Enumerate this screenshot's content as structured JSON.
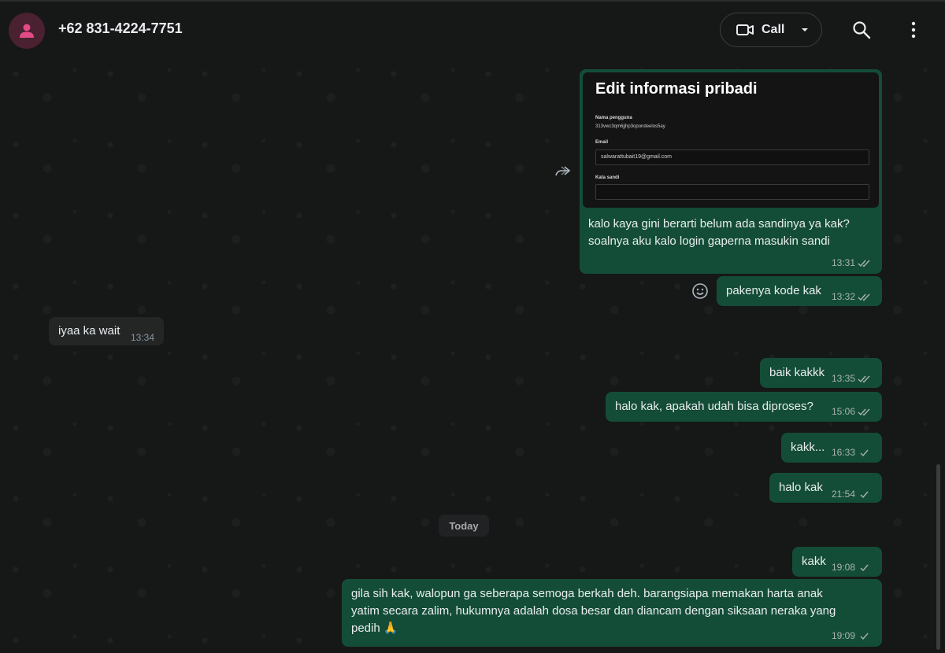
{
  "header": {
    "contact_name": "+62 831-4224-7751",
    "call_label": "Call",
    "avatar_icon": "person-icon",
    "video_icon": "video-camera-icon",
    "dropdown_icon": "chevron-down-icon",
    "search_icon": "search-icon",
    "menu_icon": "more-vertical-icon"
  },
  "colors": {
    "outgoing": "#144d37",
    "incoming": "#242626",
    "background": "#161717",
    "avatar": "#4a2130",
    "avatar_glyph": "#e24b86"
  },
  "screenshot": {
    "title": "Edit informasi pribadi",
    "username_label": "Nama pengguna",
    "username_value": "313vwc3qm6jjhp3opondeelos5ay",
    "email_label": "Email",
    "email_value": "salwarattubait19@gmail.com",
    "password_label": "Kata sandi"
  },
  "messages": [
    {
      "text": "kalo kaya gini berarti belum ada sandinya ya kak?",
      "text2": "soalnya aku kalo login gaperna masukin sandi",
      "time": "13:31",
      "status": "read"
    },
    {
      "text": "pakenya kode kak",
      "time": "13:32",
      "status": "read"
    },
    {
      "text": "iyaa ka wait",
      "time": "13:34"
    },
    {
      "text": "baik kakkk",
      "time": "13:35",
      "status": "read"
    },
    {
      "text": "halo kak, apakah udah bisa diproses?",
      "time": "15:06",
      "status": "read"
    },
    {
      "text": "kakk...",
      "time": "16:33",
      "status": "sent"
    },
    {
      "text": "halo kak",
      "time": "21:54",
      "status": "sent"
    },
    {
      "text": "kakk",
      "time": "19:08",
      "status": "sent"
    },
    {
      "text": "gila sih kak, walopun ga seberapa semoga berkah deh.  barangsiapa memakan harta anak",
      "text2": "yatim secara zalim, hukumnya adalah dosa besar dan diancam dengan siksaan neraka yang",
      "text3": "pedih 🙏",
      "time": "19:09",
      "status": "sent"
    }
  ],
  "day_divider": "Today",
  "icons": {
    "forward": "forward-icon",
    "emoji": "emoji-icon"
  }
}
